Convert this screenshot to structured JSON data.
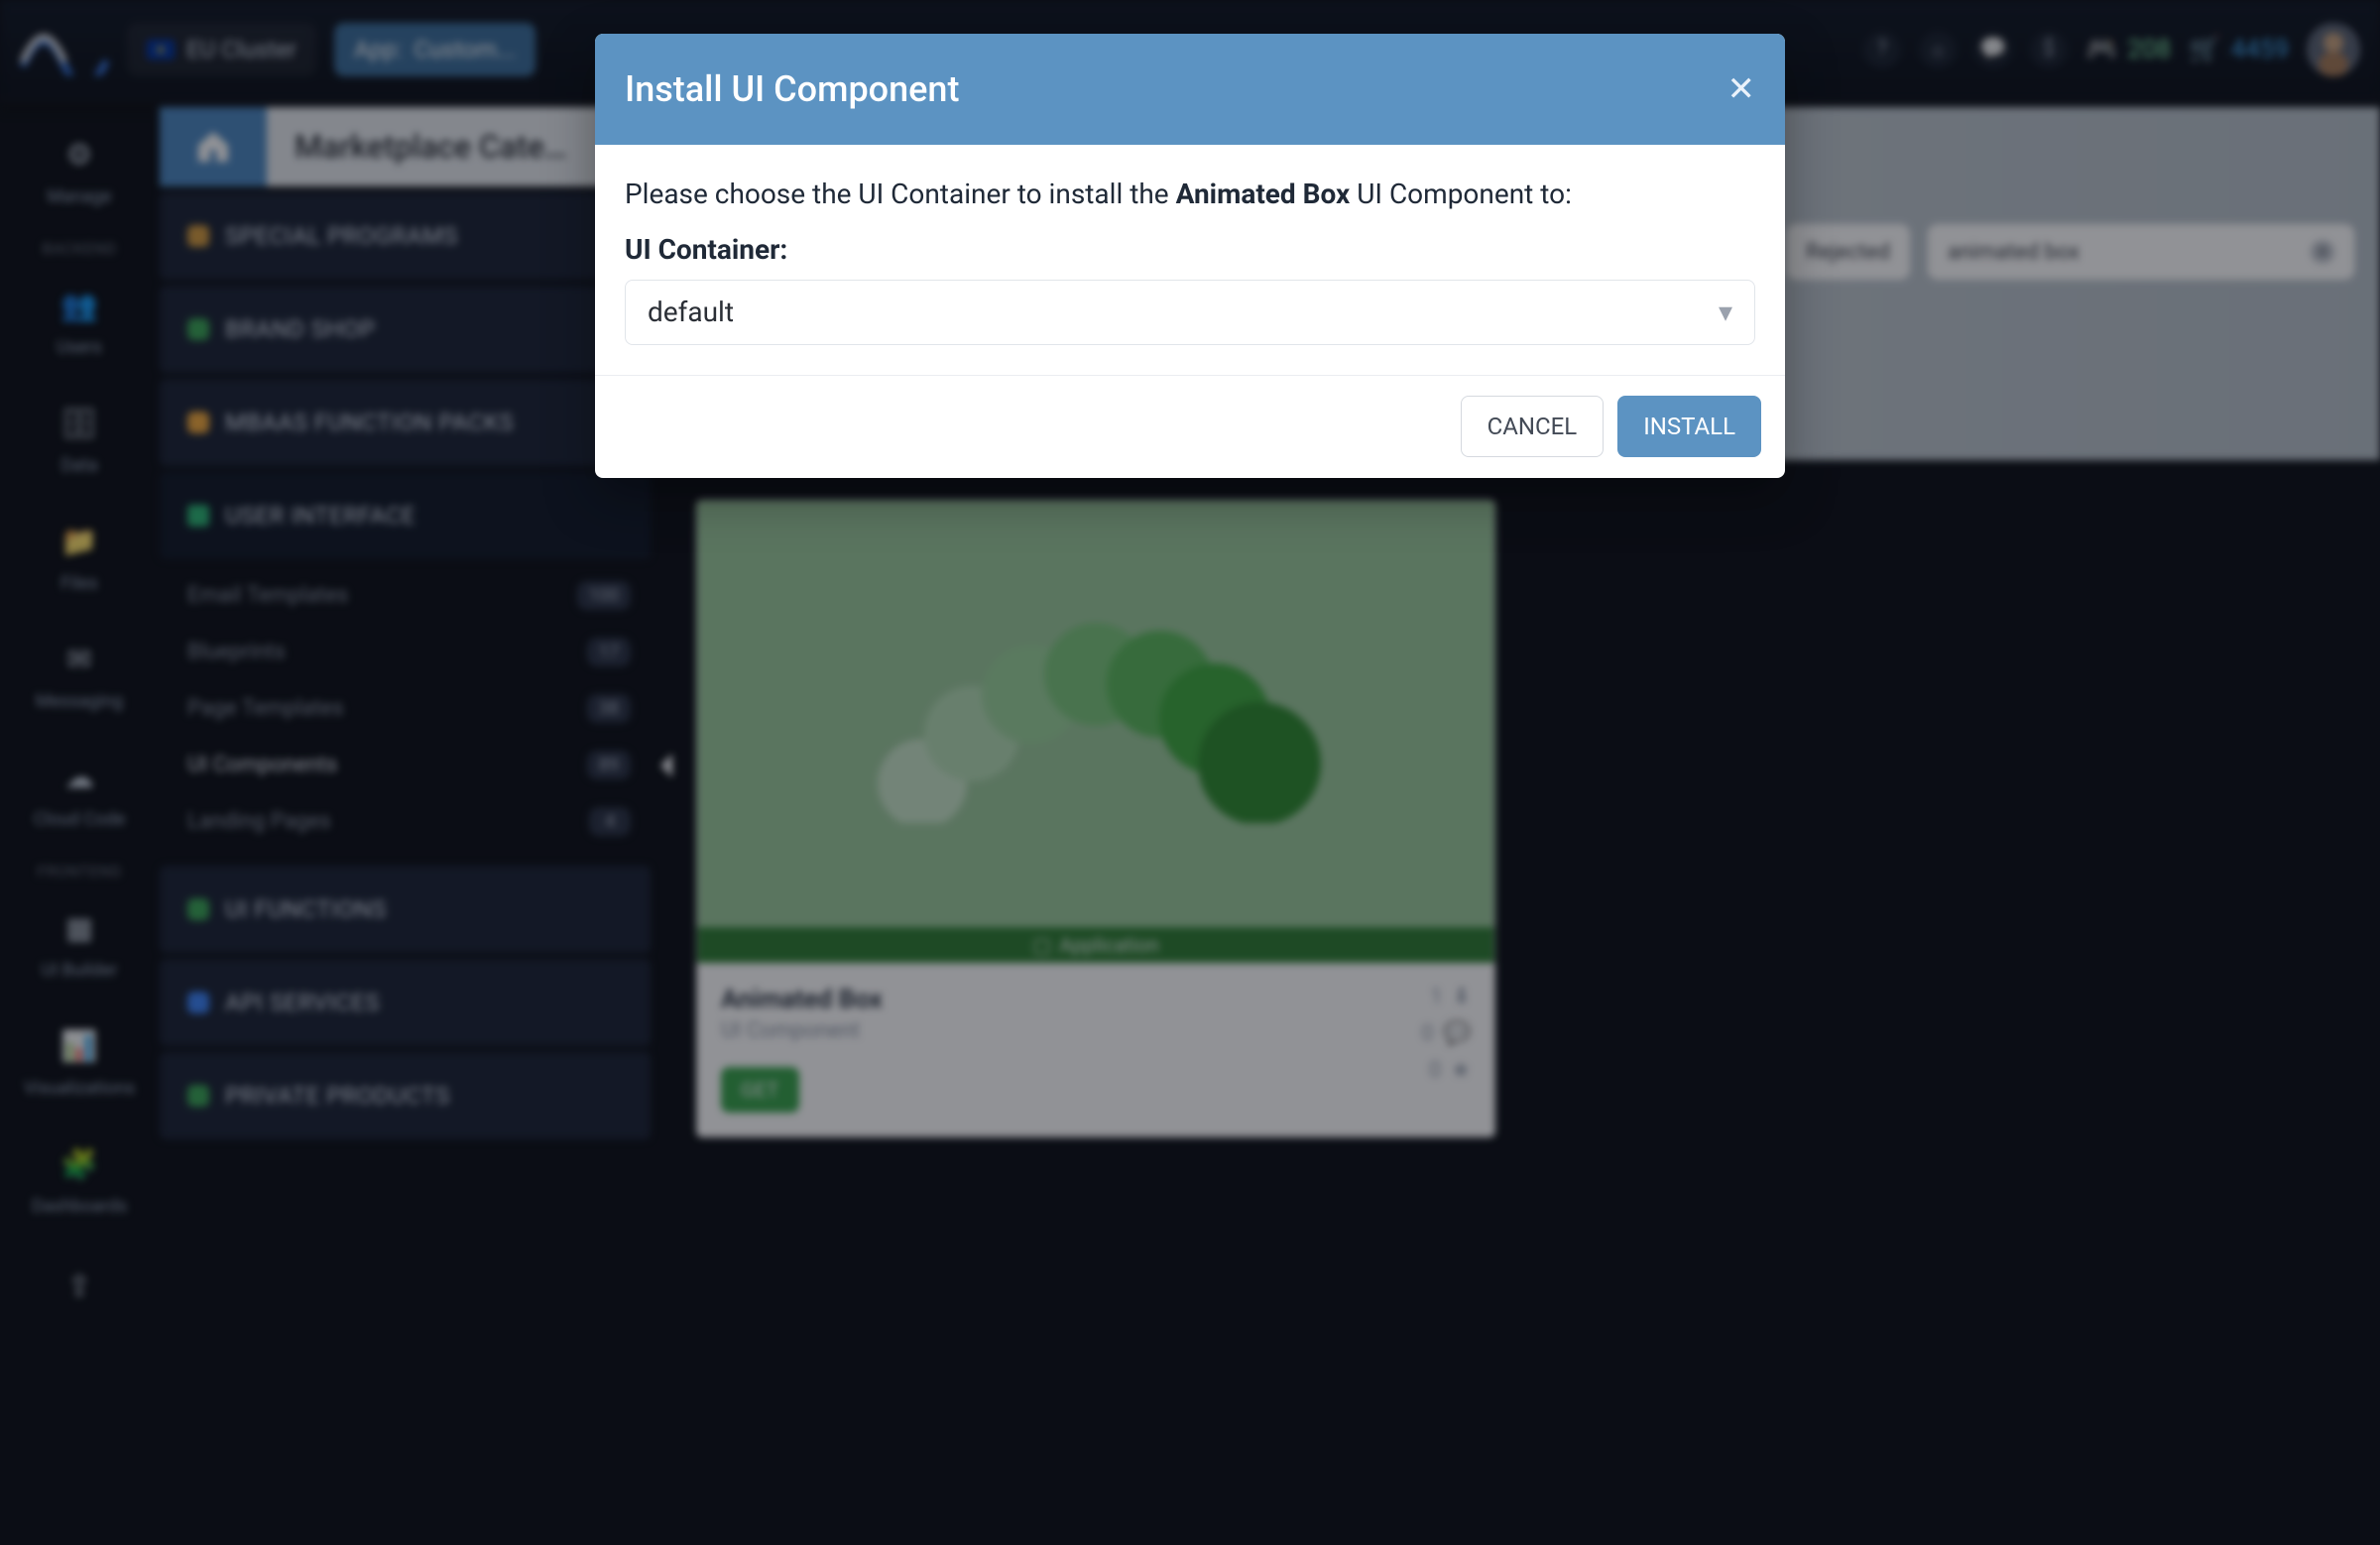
{
  "topbar": {
    "cluster": "EU Cluster",
    "app_prefix": "App: ",
    "app_name": "Custom...",
    "score_green": "208",
    "score_blue": "4459"
  },
  "rail": {
    "section1": "BACKEND",
    "section2": "FRONTEND",
    "items": [
      {
        "label": "Manage"
      },
      {
        "label": "Users"
      },
      {
        "label": "Data"
      },
      {
        "label": "Files"
      },
      {
        "label": "Messaging"
      },
      {
        "label": "Cloud Code"
      },
      {
        "label": "UI Builder"
      },
      {
        "label": "Visualizations"
      },
      {
        "label": "Dashboards"
      }
    ]
  },
  "breadcrumb": {
    "title": "Marketplace Cate…"
  },
  "accordion": [
    {
      "label": "SPECIAL PROGRAMS",
      "color": "#d39a3d"
    },
    {
      "label": "BRAND SHOP",
      "color": "#3aa655"
    },
    {
      "label": "MBAAS FUNCTION PACKS",
      "color": "#f2a93b"
    },
    {
      "label": "USER INTERFACE",
      "color": "#2bb673",
      "expanded": true,
      "subs": [
        {
          "label": "Email Templates",
          "count": "100"
        },
        {
          "label": "Blueprints",
          "count": "17"
        },
        {
          "label": "Page Templates",
          "count": "38"
        },
        {
          "label": "UI Components",
          "count": "89",
          "active": true
        },
        {
          "label": "Landing Pages",
          "count": "4"
        }
      ]
    },
    {
      "label": "UI FUNCTIONS",
      "color": "#3aa655"
    },
    {
      "label": "API SERVICES",
      "color": "#3b82f6"
    },
    {
      "label": "PRIVATE PRODUCTS",
      "color": "#3aa655"
    }
  ],
  "tool_sort": "Rejected",
  "search": {
    "value": "animated box"
  },
  "card": {
    "ribbon": "Application",
    "title": "Animated Box",
    "subtitle": "UI Component",
    "get": "GET",
    "stats": {
      "downloads": "1",
      "comments": "0",
      "stars": "0"
    }
  },
  "modal": {
    "title": "Install UI Component",
    "lead_prefix": "Please choose the UI Container to install the ",
    "lead_component": "Animated Box",
    "lead_suffix": " UI Component to:",
    "field_label": "UI Container:",
    "select_value": "default",
    "cancel": "CANCEL",
    "install": "INSTALL"
  }
}
